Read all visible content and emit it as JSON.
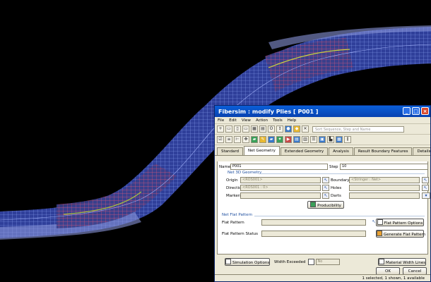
{
  "window": {
    "title": "Fibersim : modify Plies [ P001 ]"
  },
  "menu": [
    "File",
    "Edit",
    "View",
    "Action",
    "Tools",
    "Help"
  ],
  "toolbar": {
    "search_placeholder": "Sort Sequence, Step and Name"
  },
  "tabs": [
    "Standard",
    "Net Geometry",
    "Extended Geometry",
    "Analysis",
    "Result Boundary Features",
    "Details"
  ],
  "active_tab": "Net Geometry",
  "fields": {
    "name_label": "Name*",
    "name_value": "P001",
    "step_label": "Step",
    "step_value": "10"
  },
  "net3d": {
    "group_label": "Net 3D Geometry",
    "origin_label": "Origin",
    "origin_value": "<ROS001>",
    "boundary_label": "Boundary",
    "boundary_value": "<Stringer : Net>",
    "direction_label": "Direction",
    "direction_value": "<ROS001 : 0>",
    "holes_label": "Holes",
    "markers_label": "Markers",
    "darts_label": "Darts",
    "producibility_label": "Producibility"
  },
  "netflat": {
    "group_label": "Net Flat Pattern",
    "flat_pattern_label": "Flat Pattern",
    "flat_pattern_status_label": "Flat Pattern Status",
    "options_button": "Flat Pattern Options",
    "generate_button": "Generate Flat Pattern"
  },
  "bottom": {
    "simulation_options": "Simulation Options",
    "width_exceeded_label": "Width Exceeded",
    "width_exceeded_value": "No",
    "material_width_lines": "Material Width Lines",
    "ok": "OK",
    "cancel": "Cancel"
  },
  "status": "1 selected, 1 shown, 1 available",
  "colors": {
    "mesh": "#4a5cc8",
    "ply": "#cc3344",
    "accent": "#0a5fd8"
  }
}
